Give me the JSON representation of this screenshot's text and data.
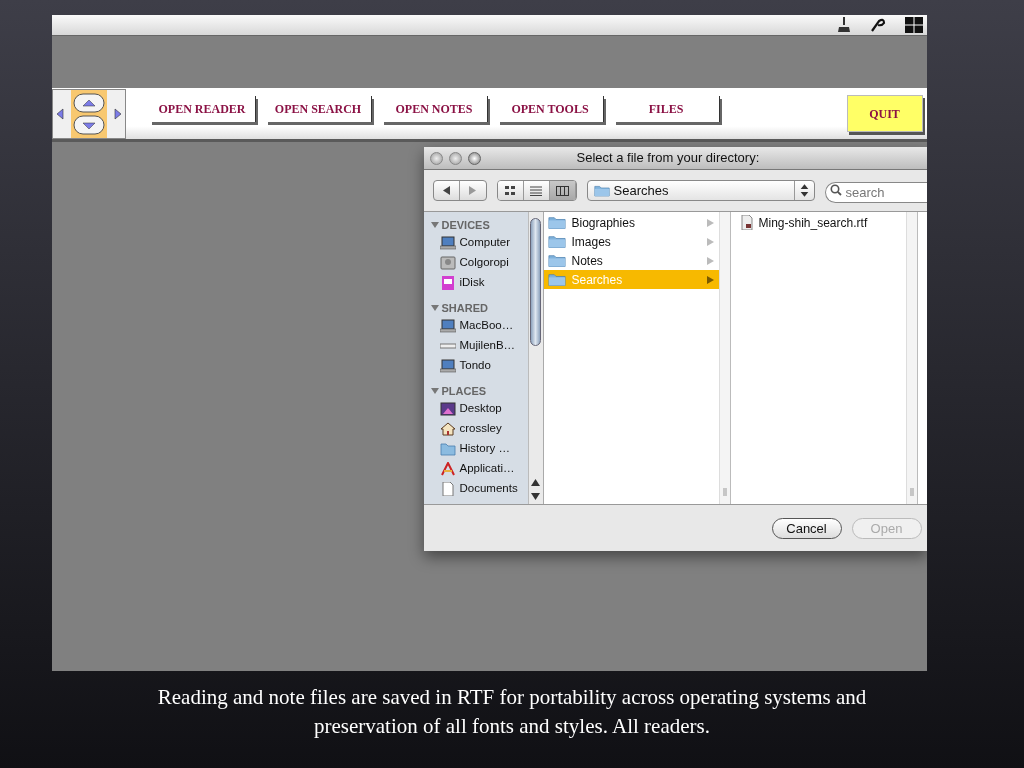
{
  "toolbar": {
    "buttons": [
      {
        "label": "OPEN READER",
        "kind": "plain"
      },
      {
        "label": "OPEN SEARCH",
        "kind": "plain"
      },
      {
        "label": "OPEN NOTES",
        "kind": "plain"
      },
      {
        "label": "OPEN TOOLS",
        "kind": "plain"
      },
      {
        "label": "FILES",
        "kind": "plain"
      },
      {
        "label": "QUIT",
        "kind": "quit"
      }
    ]
  },
  "dialog": {
    "title": "Select a file from your directory:",
    "view_modes": [
      {
        "kind": "icons",
        "selected": false
      },
      {
        "kind": "list",
        "selected": false
      },
      {
        "kind": "columns",
        "selected": true
      }
    ],
    "location": "Searches",
    "search": {
      "placeholder": "search"
    },
    "sidebar": [
      {
        "title": "DEVICES",
        "expanded": true,
        "items": [
          {
            "label": "Computer",
            "kind": "computer"
          },
          {
            "label": "Colgoropi",
            "kind": "disk"
          },
          {
            "label": "iDisk",
            "kind": "idisk"
          }
        ]
      },
      {
        "title": "SHARED",
        "expanded": true,
        "items": [
          {
            "label": "MacBoo…",
            "kind": "computer"
          },
          {
            "label": "MujilenB…",
            "kind": "server"
          },
          {
            "label": "Tondo",
            "kind": "computer"
          }
        ]
      },
      {
        "title": "PLACES",
        "expanded": true,
        "items": [
          {
            "label": "Desktop",
            "kind": "desktop"
          },
          {
            "label": "crossley",
            "kind": "home"
          },
          {
            "label": "History …",
            "kind": "folder"
          },
          {
            "label": "Applicati…",
            "kind": "apps"
          },
          {
            "label": "Documents",
            "kind": "document"
          }
        ]
      }
    ],
    "columns": [
      {
        "items": [
          {
            "label": "Biographies",
            "kind": "folder",
            "selected": false
          },
          {
            "label": "Images",
            "kind": "folder",
            "selected": false
          },
          {
            "label": "Notes",
            "kind": "folder",
            "selected": false
          },
          {
            "label": "Searches",
            "kind": "folder",
            "selected": true
          }
        ]
      },
      {
        "items": [
          {
            "label": "Ming-shih_search.rtf",
            "kind": "file",
            "selected": false
          }
        ]
      }
    ],
    "buttons": [
      {
        "label": "Cancel",
        "disabled": false
      },
      {
        "label": "Open",
        "disabled": true
      }
    ]
  },
  "caption": "Reading and note files are saved in RTF for portability across operating systems and preservation of all fonts and styles. All readers."
}
